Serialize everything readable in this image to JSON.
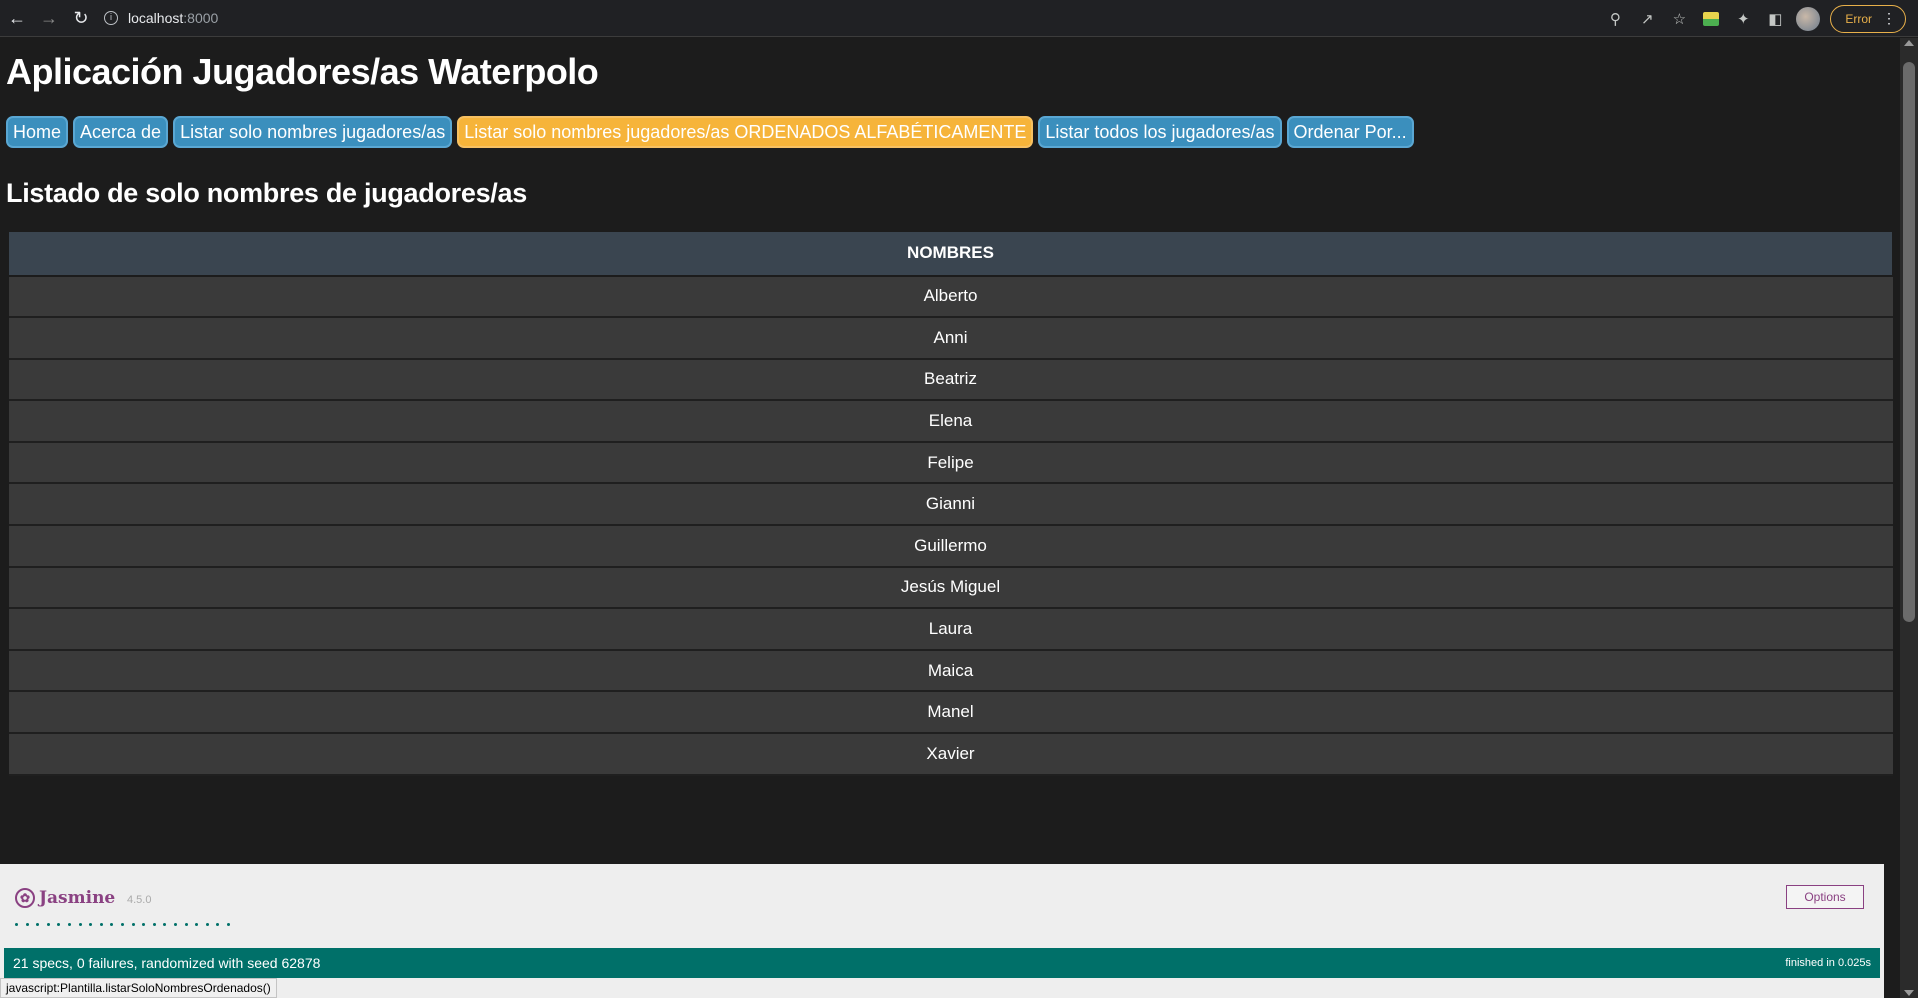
{
  "browser": {
    "url_host": "localhost",
    "url_port": ":8000",
    "error_label": "Error",
    "icons": [
      "back-icon",
      "forward-icon",
      "reload-icon",
      "info-icon",
      "zoom-icon",
      "share-icon",
      "star-icon",
      "extension-icon",
      "puzzle-icon",
      "sidepanel-icon",
      "avatar",
      "menu-icon"
    ]
  },
  "page": {
    "title": "Aplicación Jugadores/as Waterpolo",
    "menu": [
      {
        "label": "Home",
        "active": false
      },
      {
        "label": "Acerca de",
        "active": false
      },
      {
        "label": "Listar solo nombres jugadores/as",
        "active": false
      },
      {
        "label": "Listar solo nombres jugadores/as ORDENADOS ALFABÉTICAMENTE",
        "active": true
      },
      {
        "label": "Listar todos los jugadores/as",
        "active": false
      },
      {
        "label": "Ordenar Por...",
        "active": false
      }
    ],
    "subtitle": "Listado de solo nombres de jugadores/as",
    "table_header": "NOMBRES",
    "names": [
      "Alberto",
      "Anni",
      "Beatriz",
      "Elena",
      "Felipe",
      "Gianni",
      "Guillermo",
      "Jesús Miguel",
      "Laura",
      "Maica",
      "Manel",
      "Xavier"
    ]
  },
  "jasmine": {
    "logo": "Jasmine",
    "version": "4.5.0",
    "options_label": "Options",
    "spec_count": 21,
    "summary": "21 specs, 0 failures, randomized with seed 62878",
    "finished": "finished in 0.025s",
    "bar_color": "#007069"
  },
  "status_bar": "javascript:Plantilla.listarSoloNombresOrdenados()"
}
